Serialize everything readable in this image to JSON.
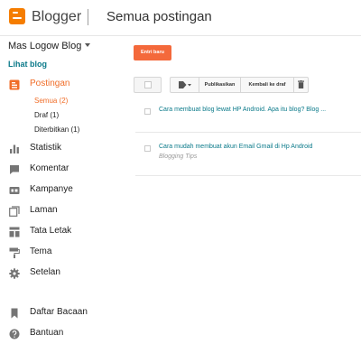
{
  "header": {
    "brand": "Blogger",
    "title": "Semua postingan"
  },
  "sidebar": {
    "blog_name": "Mas Logow Blog",
    "view_blog": "Lihat blog",
    "posts_label": "Postingan",
    "sub_items": [
      {
        "label": "Semua (2)"
      },
      {
        "label": "Draf (1)"
      },
      {
        "label": "Diterbitkan (1)"
      }
    ],
    "items": [
      {
        "label": "Statistik",
        "icon": "bar-chart-icon"
      },
      {
        "label": "Komentar",
        "icon": "comment-icon"
      },
      {
        "label": "Kampanye",
        "icon": "ad-icon"
      },
      {
        "label": "Laman",
        "icon": "pages-icon"
      },
      {
        "label": "Tata Letak",
        "icon": "layout-icon"
      },
      {
        "label": "Tema",
        "icon": "paint-roller-icon"
      },
      {
        "label": "Setelan",
        "icon": "gear-icon"
      },
      {
        "label": "Daftar Bacaan",
        "icon": "bookmark-icon"
      },
      {
        "label": "Bantuan",
        "icon": "help-icon"
      }
    ]
  },
  "main": {
    "new_post": "Entri baru",
    "toolbar": {
      "publish": "Publikasikan",
      "revert": "Kembali ke draf"
    },
    "posts": [
      {
        "title": "Cara membuat blog lewat HP Android. Apa itu blog? Blog ...",
        "tag": ""
      },
      {
        "title": "Cara mudah membuat akun Email Gmail di Hp Android",
        "tag": "Blogging Tips"
      }
    ]
  },
  "colors": {
    "accent": "#f06d28",
    "link": "#0b7a8a",
    "brand": "#f57d00"
  }
}
